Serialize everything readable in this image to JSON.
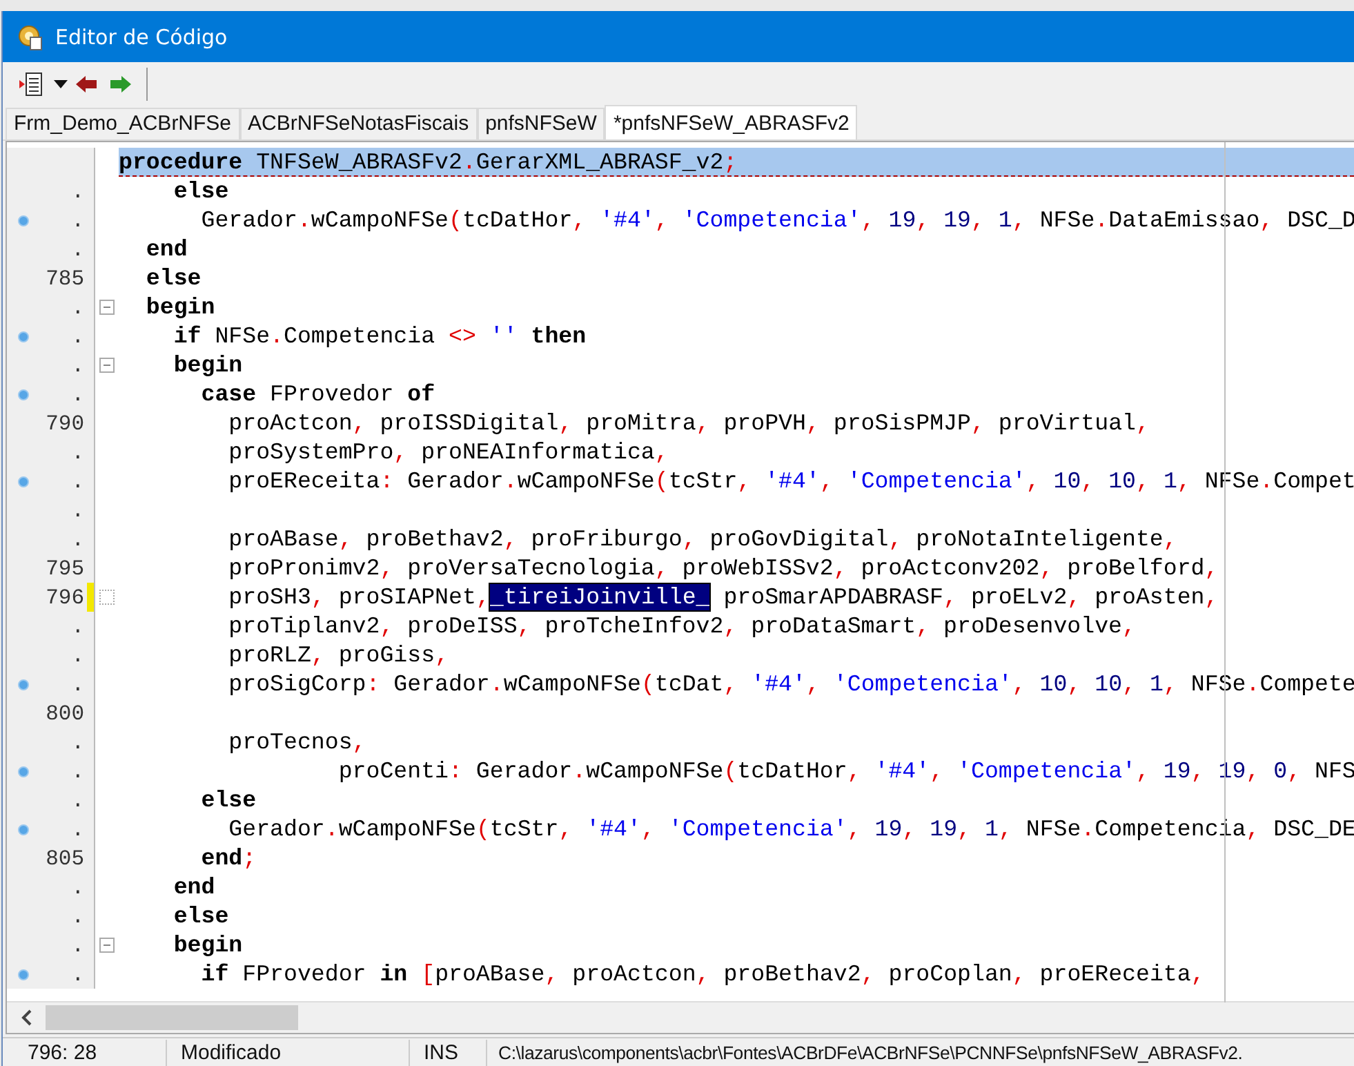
{
  "window": {
    "title": "Editor de Código"
  },
  "tabs": [
    {
      "label": "Frm_Demo_ACBrNFSe",
      "selected": false
    },
    {
      "label": "ACBrNFSeNotasFiscais",
      "selected": false
    },
    {
      "label": "pnfsNFSeW",
      "selected": false
    },
    {
      "label": "*pnfsNFSeW_ABRASFv2",
      "selected": true
    }
  ],
  "editor": {
    "lines": [
      {
        "bookmark": false,
        "modified": false,
        "current": true,
        "tokens": [
          {
            "kind": "keyword",
            "text": "procedure"
          },
          {
            "kind": "name",
            "text": " TNFSeW_ABRASFv2"
          },
          {
            "kind": "symbol",
            "text": "."
          },
          {
            "kind": "name",
            "text": "GerarXML_ABRASF_v2"
          },
          {
            "kind": "symbol",
            "text": ";"
          }
        ]
      },
      {
        "number": ".",
        "bookmark": false,
        "modified": false,
        "current": false,
        "tokens": [
          {
            "kind": "keyword",
            "text": "    else"
          }
        ]
      },
      {
        "number": ".",
        "bookmark": true,
        "modified": false,
        "current": false,
        "tokens": [
          {
            "kind": "name",
            "text": "      Gerador"
          },
          {
            "kind": "symbol",
            "text": "."
          },
          {
            "kind": "name",
            "text": "wCampoNFSe"
          },
          {
            "kind": "symbol",
            "text": "("
          },
          {
            "kind": "name",
            "text": "tcDatHor"
          },
          {
            "kind": "symbol",
            "text": ","
          },
          {
            "kind": "string",
            "text": " '#4'"
          },
          {
            "kind": "symbol",
            "text": ","
          },
          {
            "kind": "string",
            "text": " 'Competencia'"
          },
          {
            "kind": "symbol",
            "text": ","
          },
          {
            "kind": "number",
            "text": " 19"
          },
          {
            "kind": "symbol",
            "text": ","
          },
          {
            "kind": "number",
            "text": " 19"
          },
          {
            "kind": "symbol",
            "text": ","
          },
          {
            "kind": "number",
            "text": " 1"
          },
          {
            "kind": "symbol",
            "text": ","
          },
          {
            "kind": "name",
            "text": " NFSe"
          },
          {
            "kind": "symbol",
            "text": "."
          },
          {
            "kind": "name",
            "text": "DataEmissao"
          },
          {
            "kind": "symbol",
            "text": ","
          },
          {
            "kind": "name",
            "text": " DSC_D"
          }
        ]
      },
      {
        "number": ".",
        "bookmark": false,
        "modified": false,
        "current": false,
        "tokens": [
          {
            "kind": "keyword",
            "text": "  end"
          }
        ]
      },
      {
        "number": "785",
        "bookmark": false,
        "modified": false,
        "current": false,
        "tokens": [
          {
            "kind": "keyword",
            "text": "  else"
          }
        ]
      },
      {
        "number": ".",
        "bookmark": false,
        "fold_toggle": true,
        "modified": false,
        "current": false,
        "tokens": [
          {
            "kind": "keyword",
            "text": "  begin"
          }
        ]
      },
      {
        "number": ".",
        "bookmark": true,
        "modified": false,
        "current": false,
        "tokens": [
          {
            "kind": "keyword",
            "text": "    if"
          },
          {
            "kind": "name",
            "text": " NFSe"
          },
          {
            "kind": "symbol",
            "text": "."
          },
          {
            "kind": "name",
            "text": "Competencia "
          },
          {
            "kind": "symbol",
            "text": "<>"
          },
          {
            "kind": "string",
            "text": " ''"
          },
          {
            "kind": "keyword",
            "text": " then"
          }
        ]
      },
      {
        "number": ".",
        "bookmark": false,
        "fold_toggle": true,
        "modified": false,
        "current": false,
        "tokens": [
          {
            "kind": "keyword",
            "text": "    begin"
          }
        ]
      },
      {
        "number": ".",
        "bookmark": true,
        "modified": false,
        "current": false,
        "tokens": [
          {
            "kind": "keyword",
            "text": "      case"
          },
          {
            "kind": "name",
            "text": " FProvedor "
          },
          {
            "kind": "keyword",
            "text": "of"
          }
        ]
      },
      {
        "number": "790",
        "bookmark": false,
        "modified": false,
        "current": false,
        "tokens": [
          {
            "kind": "name",
            "text": "        proActcon"
          },
          {
            "kind": "symbol",
            "text": ","
          },
          {
            "kind": "name",
            "text": " proISSDigital"
          },
          {
            "kind": "symbol",
            "text": ","
          },
          {
            "kind": "name",
            "text": " proMitra"
          },
          {
            "kind": "symbol",
            "text": ","
          },
          {
            "kind": "name",
            "text": " proPVH"
          },
          {
            "kind": "symbol",
            "text": ","
          },
          {
            "kind": "name",
            "text": " proSisPMJP"
          },
          {
            "kind": "symbol",
            "text": ","
          },
          {
            "kind": "name",
            "text": " proVirtual"
          },
          {
            "kind": "symbol",
            "text": ","
          }
        ]
      },
      {
        "number": ".",
        "bookmark": false,
        "modified": false,
        "current": false,
        "tokens": [
          {
            "kind": "name",
            "text": "        proSystemPro"
          },
          {
            "kind": "symbol",
            "text": ","
          },
          {
            "kind": "name",
            "text": " proNEAInformatica"
          },
          {
            "kind": "symbol",
            "text": ","
          }
        ]
      },
      {
        "number": ".",
        "bookmark": true,
        "modified": false,
        "current": false,
        "tokens": [
          {
            "kind": "name",
            "text": "        proEReceita"
          },
          {
            "kind": "symbol",
            "text": ":"
          },
          {
            "kind": "name",
            "text": " Gerador"
          },
          {
            "kind": "symbol",
            "text": "."
          },
          {
            "kind": "name",
            "text": "wCampoNFSe"
          },
          {
            "kind": "symbol",
            "text": "("
          },
          {
            "kind": "name",
            "text": "tcStr"
          },
          {
            "kind": "symbol",
            "text": ","
          },
          {
            "kind": "string",
            "text": " '#4'"
          },
          {
            "kind": "symbol",
            "text": ","
          },
          {
            "kind": "string",
            "text": " 'Competencia'"
          },
          {
            "kind": "symbol",
            "text": ","
          },
          {
            "kind": "number",
            "text": " 10"
          },
          {
            "kind": "symbol",
            "text": ","
          },
          {
            "kind": "number",
            "text": " 10"
          },
          {
            "kind": "symbol",
            "text": ","
          },
          {
            "kind": "number",
            "text": " 1"
          },
          {
            "kind": "symbol",
            "text": ","
          },
          {
            "kind": "name",
            "text": " NFSe"
          },
          {
            "kind": "symbol",
            "text": "."
          },
          {
            "kind": "name",
            "text": "Compet"
          }
        ]
      },
      {
        "number": ".",
        "bookmark": false,
        "modified": false,
        "current": false
      },
      {
        "number": ".",
        "bookmark": false,
        "modified": false,
        "current": false,
        "tokens": [
          {
            "kind": "name",
            "text": "        proABase"
          },
          {
            "kind": "symbol",
            "text": ","
          },
          {
            "kind": "name",
            "text": " proBethav2"
          },
          {
            "kind": "symbol",
            "text": ","
          },
          {
            "kind": "name",
            "text": " proFriburgo"
          },
          {
            "kind": "symbol",
            "text": ","
          },
          {
            "kind": "name",
            "text": " proGovDigital"
          },
          {
            "kind": "symbol",
            "text": ","
          },
          {
            "kind": "name",
            "text": " proNotaInteligente"
          },
          {
            "kind": "symbol",
            "text": ","
          }
        ]
      },
      {
        "number": "795",
        "bookmark": false,
        "modified": false,
        "current": false,
        "tokens": [
          {
            "kind": "name",
            "text": "        proPronimv2"
          },
          {
            "kind": "symbol",
            "text": ","
          },
          {
            "kind": "name",
            "text": " proVersaTecnologia"
          },
          {
            "kind": "symbol",
            "text": ","
          },
          {
            "kind": "name",
            "text": " proWebISSv2"
          },
          {
            "kind": "symbol",
            "text": ","
          },
          {
            "kind": "name",
            "text": " proActconv202"
          },
          {
            "kind": "symbol",
            "text": ","
          },
          {
            "kind": "name",
            "text": " proBelford"
          },
          {
            "kind": "symbol",
            "text": ","
          }
        ]
      },
      {
        "number": "796",
        "bookmark": false,
        "fold_hint": true,
        "modified": true,
        "current": false,
        "tokens": [
          {
            "kind": "name",
            "text": "        proSH3"
          },
          {
            "kind": "symbol",
            "text": ","
          },
          {
            "kind": "name",
            "text": " proSIAPNet"
          },
          {
            "kind": "symbol",
            "text": ","
          },
          {
            "kind": "selection",
            "text": "_tireiJoinville_"
          },
          {
            "kind": "name",
            "text": " proSmarAPDABRASF"
          },
          {
            "kind": "symbol",
            "text": ","
          },
          {
            "kind": "name",
            "text": " proELv2"
          },
          {
            "kind": "symbol",
            "text": ","
          },
          {
            "kind": "name",
            "text": " proAsten"
          },
          {
            "kind": "symbol",
            "text": ","
          }
        ]
      },
      {
        "number": ".",
        "bookmark": false,
        "modified": false,
        "current": false,
        "tokens": [
          {
            "kind": "name",
            "text": "        proTiplanv2"
          },
          {
            "kind": "symbol",
            "text": ","
          },
          {
            "kind": "name",
            "text": " proDeISS"
          },
          {
            "kind": "symbol",
            "text": ","
          },
          {
            "kind": "name",
            "text": " proTcheInfov2"
          },
          {
            "kind": "symbol",
            "text": ","
          },
          {
            "kind": "name",
            "text": " proDataSmart"
          },
          {
            "kind": "symbol",
            "text": ","
          },
          {
            "kind": "name",
            "text": " proDesenvolve"
          },
          {
            "kind": "symbol",
            "text": ","
          }
        ]
      },
      {
        "number": ".",
        "bookmark": false,
        "modified": false,
        "current": false,
        "tokens": [
          {
            "kind": "name",
            "text": "        proRLZ"
          },
          {
            "kind": "symbol",
            "text": ","
          },
          {
            "kind": "name",
            "text": " proGiss"
          },
          {
            "kind": "symbol",
            "text": ","
          }
        ]
      },
      {
        "number": ".",
        "bookmark": true,
        "modified": false,
        "current": false,
        "tokens": [
          {
            "kind": "name",
            "text": "        proSigCorp"
          },
          {
            "kind": "symbol",
            "text": ":"
          },
          {
            "kind": "name",
            "text": " Gerador"
          },
          {
            "kind": "symbol",
            "text": "."
          },
          {
            "kind": "name",
            "text": "wCampoNFSe"
          },
          {
            "kind": "symbol",
            "text": "("
          },
          {
            "kind": "name",
            "text": "tcDat"
          },
          {
            "kind": "symbol",
            "text": ","
          },
          {
            "kind": "string",
            "text": " '#4'"
          },
          {
            "kind": "symbol",
            "text": ","
          },
          {
            "kind": "string",
            "text": " 'Competencia'"
          },
          {
            "kind": "symbol",
            "text": ","
          },
          {
            "kind": "number",
            "text": " 10"
          },
          {
            "kind": "symbol",
            "text": ","
          },
          {
            "kind": "number",
            "text": " 10"
          },
          {
            "kind": "symbol",
            "text": ","
          },
          {
            "kind": "number",
            "text": " 1"
          },
          {
            "kind": "symbol",
            "text": ","
          },
          {
            "kind": "name",
            "text": " NFSe"
          },
          {
            "kind": "symbol",
            "text": "."
          },
          {
            "kind": "name",
            "text": "Compete"
          }
        ]
      },
      {
        "number": "800",
        "bookmark": false,
        "modified": false,
        "current": false
      },
      {
        "number": ".",
        "bookmark": false,
        "modified": false,
        "current": false,
        "tokens": [
          {
            "kind": "name",
            "text": "        proTecnos"
          },
          {
            "kind": "symbol",
            "text": ","
          }
        ]
      },
      {
        "number": ".",
        "bookmark": true,
        "modified": false,
        "current": false,
        "tokens": [
          {
            "kind": "name",
            "text": "                proCenti"
          },
          {
            "kind": "symbol",
            "text": ":"
          },
          {
            "kind": "name",
            "text": " Gerador"
          },
          {
            "kind": "symbol",
            "text": "."
          },
          {
            "kind": "name",
            "text": "wCampoNFSe"
          },
          {
            "kind": "symbol",
            "text": "("
          },
          {
            "kind": "name",
            "text": "tcDatHor"
          },
          {
            "kind": "symbol",
            "text": ","
          },
          {
            "kind": "string",
            "text": " '#4'"
          },
          {
            "kind": "symbol",
            "text": ","
          },
          {
            "kind": "string",
            "text": " 'Competencia'"
          },
          {
            "kind": "symbol",
            "text": ","
          },
          {
            "kind": "number",
            "text": " 19"
          },
          {
            "kind": "symbol",
            "text": ","
          },
          {
            "kind": "number",
            "text": " 19"
          },
          {
            "kind": "symbol",
            "text": ","
          },
          {
            "kind": "number",
            "text": " 0"
          },
          {
            "kind": "symbol",
            "text": ","
          },
          {
            "kind": "name",
            "text": " NFS"
          }
        ]
      },
      {
        "number": ".",
        "bookmark": false,
        "modified": false,
        "current": false,
        "tokens": [
          {
            "kind": "keyword",
            "text": "      else"
          }
        ]
      },
      {
        "number": ".",
        "bookmark": true,
        "modified": false,
        "current": false,
        "tokens": [
          {
            "kind": "name",
            "text": "        Gerador"
          },
          {
            "kind": "symbol",
            "text": "."
          },
          {
            "kind": "name",
            "text": "wCampoNFSe"
          },
          {
            "kind": "symbol",
            "text": "("
          },
          {
            "kind": "name",
            "text": "tcStr"
          },
          {
            "kind": "symbol",
            "text": ","
          },
          {
            "kind": "string",
            "text": " '#4'"
          },
          {
            "kind": "symbol",
            "text": ","
          },
          {
            "kind": "string",
            "text": " 'Competencia'"
          },
          {
            "kind": "symbol",
            "text": ","
          },
          {
            "kind": "number",
            "text": " 19"
          },
          {
            "kind": "symbol",
            "text": ","
          },
          {
            "kind": "number",
            "text": " 19"
          },
          {
            "kind": "symbol",
            "text": ","
          },
          {
            "kind": "number",
            "text": " 1"
          },
          {
            "kind": "symbol",
            "text": ","
          },
          {
            "kind": "name",
            "text": " NFSe"
          },
          {
            "kind": "symbol",
            "text": "."
          },
          {
            "kind": "name",
            "text": "Competencia"
          },
          {
            "kind": "symbol",
            "text": ","
          },
          {
            "kind": "name",
            "text": " DSC_DE"
          }
        ]
      },
      {
        "number": "805",
        "bookmark": false,
        "modified": false,
        "current": false,
        "tokens": [
          {
            "kind": "keyword",
            "text": "      end"
          },
          {
            "kind": "symbol",
            "text": ";"
          }
        ]
      },
      {
        "number": ".",
        "bookmark": false,
        "modified": false,
        "current": false,
        "tokens": [
          {
            "kind": "keyword",
            "text": "    end"
          }
        ]
      },
      {
        "number": ".",
        "bookmark": false,
        "modified": false,
        "current": false,
        "tokens": [
          {
            "kind": "keyword",
            "text": "    else"
          }
        ]
      },
      {
        "number": ".",
        "bookmark": false,
        "fold_toggle": true,
        "modified": false,
        "current": false,
        "tokens": [
          {
            "kind": "keyword",
            "text": "    begin"
          }
        ]
      },
      {
        "number": ".",
        "bookmark": true,
        "modified": false,
        "current": false,
        "tokens": [
          {
            "kind": "keyword",
            "text": "      if"
          },
          {
            "kind": "name",
            "text": " FProvedor "
          },
          {
            "kind": "keyword",
            "text": "in"
          },
          {
            "kind": "symbol",
            "text": " ["
          },
          {
            "kind": "name",
            "text": "proABase"
          },
          {
            "kind": "symbol",
            "text": ","
          },
          {
            "kind": "name",
            "text": " proActcon"
          },
          {
            "kind": "symbol",
            "text": ","
          },
          {
            "kind": "name",
            "text": " proBethav2"
          },
          {
            "kind": "symbol",
            "text": ","
          },
          {
            "kind": "name",
            "text": " proCoplan"
          },
          {
            "kind": "symbol",
            "text": ","
          },
          {
            "kind": "name",
            "text": " proEReceita"
          },
          {
            "kind": "symbol",
            "text": ","
          }
        ]
      }
    ]
  },
  "status_bar": {
    "position": "796: 28",
    "state": "Modificado",
    "mode": "INS",
    "path": "C:\\lazarus\\components\\acbr\\Fontes\\ACBrDFe\\ACBrNFSe\\PCNNFSe\\pnfsNFSeW_ABRASFv2."
  }
}
